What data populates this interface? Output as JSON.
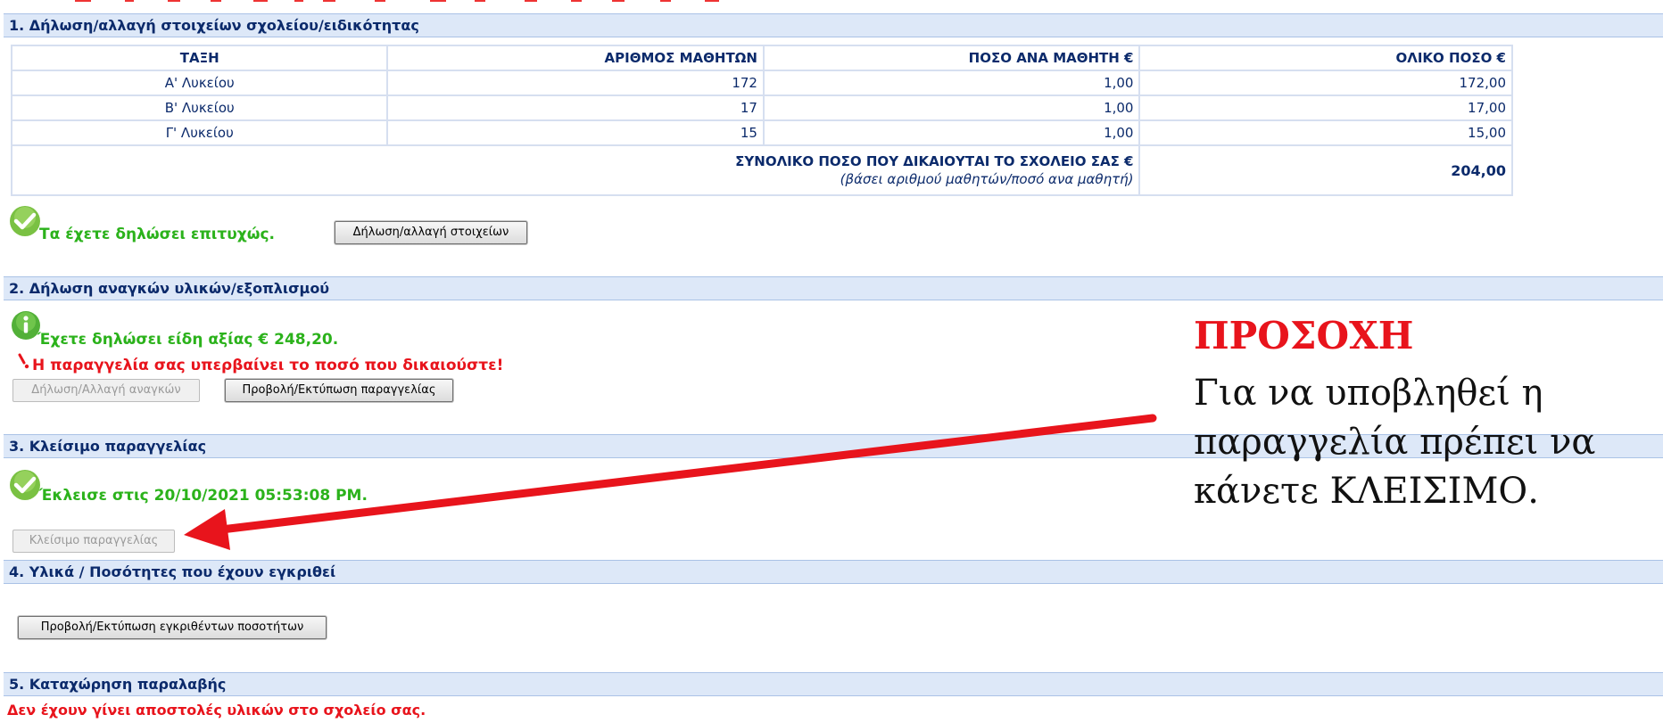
{
  "sections": {
    "s1_title": "1. Δήλωση/αλλαγή στοιχείων σχολείου/ειδικότητας",
    "s2_title": "2. Δήλωση αναγκών υλικών/εξοπλισμού",
    "s3_title": "3. Κλείσιμο παραγγελίας",
    "s4_title": "4. Υλικά / Ποσότητες που έχουν εγκριθεί",
    "s5_title": "5. Καταχώρηση παραλαβής"
  },
  "table": {
    "headers": [
      "ΤΑΞΗ",
      "ΑΡΙΘΜΟΣ ΜΑΘΗΤΩΝ",
      "ΠΟΣΟ ΑΝΑ ΜΑΘΗΤΗ €",
      "ΟΛΙΚΟ ΠΟΣΟ €"
    ],
    "rows": [
      [
        "Α' Λυκείου",
        "172",
        "1,00",
        "172,00"
      ],
      [
        "Β' Λυκείου",
        "17",
        "1,00",
        "17,00"
      ],
      [
        "Γ' Λυκείου",
        "15",
        "1,00",
        "15,00"
      ]
    ],
    "total_label": "ΣΥΝΟΛΙΚΟ ΠΟΣΟ ΠΟΥ ΔΙΚΑΙΟΥΤΑΙ ΤΟ ΣΧΟΛΕΙΟ ΣΑΣ €",
    "total_note": "(βάσει αριθμού μαθητών/ποσό ανα μαθητή)",
    "total_value": "204,00"
  },
  "s1": {
    "success_msg": "Τα έχετε δηλώσει επιτυχώς.",
    "edit_button": "Δήλωση/αλλαγή στοιχείων"
  },
  "s2": {
    "info_msg": "Έχετε δηλώσει είδη αξίας € 248,20.",
    "warning_msg": "Η παραγγελία σας υπερβαίνει το ποσό που δικαιούστε!",
    "needs_button": "Δήλωση/Αλλαγή αναγκών",
    "view_button": "Προβολή/Εκτύπωση παραγγελίας"
  },
  "s3": {
    "closed_msg": "Έκλεισε στις 20/10/2021 05:53:08 PM.",
    "close_button": "Κλείσιμο παραγγελίας"
  },
  "s4": {
    "view_approved_button": "Προβολή/Εκτύπωση εγκριθέντων ποσοτήτων"
  },
  "s5": {
    "no_shipments_msg": "Δεν έχουν γίνει αποστολές υλικών στο σχολείο σας."
  },
  "callout": {
    "title": "ΠΡΟΣΟΧΗ",
    "line1": "Για να υποβληθεί η",
    "line2": "παραγγελία πρέπει να",
    "line3": "κάνετε ΚΛΕΙΣΙΜΟ."
  },
  "colors": {
    "section_bg": "#dde8f8",
    "section_text": "#0b2a6b",
    "success": "#2bb21b",
    "error": "#e8141c",
    "arrow": "#e8141c"
  },
  "icons": [
    "check-icon",
    "info-icon",
    "exclamation-icon",
    "arrow-icon"
  ]
}
